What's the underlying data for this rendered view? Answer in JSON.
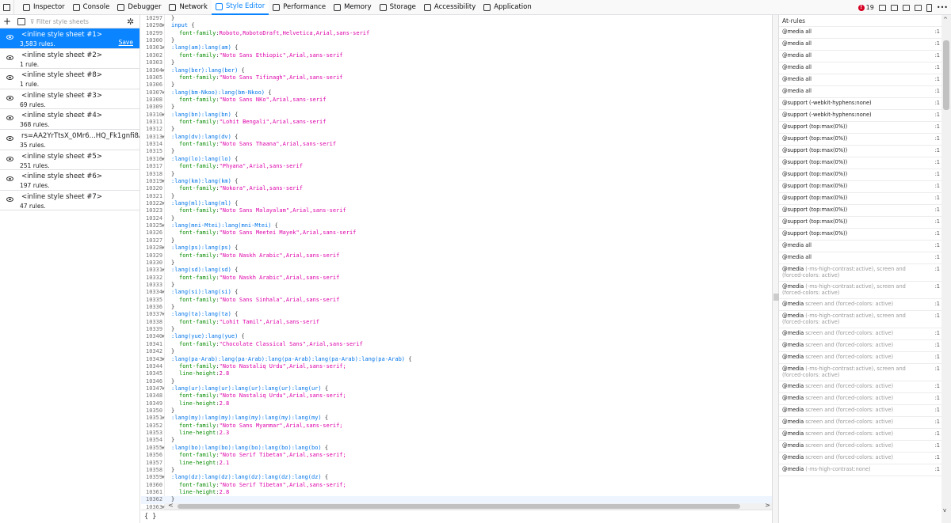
{
  "toolbar": {
    "tabs": [
      {
        "label": "Inspector",
        "icon": "inspector-icon"
      },
      {
        "label": "Console",
        "icon": "console-icon"
      },
      {
        "label": "Debugger",
        "icon": "debugger-icon"
      },
      {
        "label": "Network",
        "icon": "network-icon"
      },
      {
        "label": "Style Editor",
        "icon": "style-editor-icon",
        "active": true
      },
      {
        "label": "Performance",
        "icon": "performance-icon"
      },
      {
        "label": "Memory",
        "icon": "memory-icon"
      },
      {
        "label": "Storage",
        "icon": "storage-icon"
      },
      {
        "label": "Accessibility",
        "icon": "accessibility-icon"
      },
      {
        "label": "Application",
        "icon": "application-icon"
      }
    ],
    "error_count": "19",
    "more_label": "•••"
  },
  "sidebar": {
    "filter_placeholder": "Filter style sheets",
    "save_label": "Save",
    "sheets": [
      {
        "name": "<inline style sheet #1>",
        "rules": "3,583 rules.",
        "selected": true
      },
      {
        "name": "<inline style sheet #2>",
        "rules": "1 rule."
      },
      {
        "name": "<inline style sheet #8>",
        "rules": "1 rule."
      },
      {
        "name": "<inline style sheet #3>",
        "rules": "69 rules."
      },
      {
        "name": "<inline style sheet #4>",
        "rules": "368 rules."
      },
      {
        "name": "rs=AA2YrTtsX_0Mr6...HQ_Fk1gnfi8AjkTg",
        "rules": "35 rules."
      },
      {
        "name": "<inline style sheet #5>",
        "rules": "251 rules."
      },
      {
        "name": "<inline style sheet #6>",
        "rules": "197 rules."
      },
      {
        "name": "<inline style sheet #7>",
        "rules": "47 rules."
      }
    ]
  },
  "editor": {
    "lines": [
      {
        "n": "10297",
        "t": "}"
      },
      {
        "n": "10298",
        "f": true,
        "sel": "input",
        "open": true
      },
      {
        "n": "10299",
        "prop": "font-family",
        "val": "Roboto,RobotoDraft,Helvetica,Arial,sans-serif"
      },
      {
        "n": "10300",
        "t": "}"
      },
      {
        "n": "10301",
        "f": true,
        "sel": ":lang(am):lang(am)",
        "open": true
      },
      {
        "n": "10302",
        "prop": "font-family",
        "val": "\"Noto Sans Ethiopic\",Arial,sans-serif"
      },
      {
        "n": "10303",
        "t": "}"
      },
      {
        "n": "10304",
        "f": true,
        "sel": ":lang(ber):lang(ber)",
        "open": true
      },
      {
        "n": "10305",
        "prop": "font-family",
        "val": "\"Noto Sans Tifinagh\",Arial,sans-serif"
      },
      {
        "n": "10306",
        "t": "}"
      },
      {
        "n": "10307",
        "f": true,
        "sel": ":lang(bm-Nkoo):lang(bm-Nkoo)",
        "open": true
      },
      {
        "n": "10308",
        "prop": "font-family",
        "val": "\"Noto Sans NKo\",Arial,sans-serif"
      },
      {
        "n": "10309",
        "t": "}"
      },
      {
        "n": "10310",
        "f": true,
        "sel": ":lang(bn):lang(bn)",
        "open": true
      },
      {
        "n": "10311",
        "prop": "font-family",
        "val": "\"Lohit Bengali\",Arial,sans-serif"
      },
      {
        "n": "10312",
        "t": "}"
      },
      {
        "n": "10313",
        "f": true,
        "sel": ":lang(dv):lang(dv)",
        "open": true
      },
      {
        "n": "10314",
        "prop": "font-family",
        "val": "\"Noto Sans Thaana\",Arial,sans-serif"
      },
      {
        "n": "10315",
        "t": "}"
      },
      {
        "n": "10316",
        "f": true,
        "sel": ":lang(lo):lang(lo)",
        "open": true
      },
      {
        "n": "10317",
        "prop": "font-family",
        "val": "\"Phyana\",Arial,sans-serif"
      },
      {
        "n": "10318",
        "t": "}"
      },
      {
        "n": "10319",
        "f": true,
        "sel": ":lang(km):lang(km)",
        "open": true
      },
      {
        "n": "10320",
        "prop": "font-family",
        "val": "\"Nokora\",Arial,sans-serif"
      },
      {
        "n": "10321",
        "t": "}"
      },
      {
        "n": "10322",
        "f": true,
        "sel": ":lang(ml):lang(ml)",
        "open": true
      },
      {
        "n": "10323",
        "prop": "font-family",
        "val": "\"Noto Sans Malayalam\",Arial,sans-serif"
      },
      {
        "n": "10324",
        "t": "}"
      },
      {
        "n": "10325",
        "f": true,
        "sel": ":lang(mni-Mtei):lang(mni-Mtei)",
        "open": true
      },
      {
        "n": "10326",
        "prop": "font-family",
        "val": "\"Noto Sans Meetei Mayek\",Arial,sans-serif"
      },
      {
        "n": "10327",
        "t": "}"
      },
      {
        "n": "10328",
        "f": true,
        "sel": ":lang(ps):lang(ps)",
        "open": true
      },
      {
        "n": "10329",
        "prop": "font-family",
        "val": "\"Noto Naskh Arabic\",Arial,sans-serif"
      },
      {
        "n": "10330",
        "t": "}"
      },
      {
        "n": "10331",
        "f": true,
        "sel": ":lang(sd):lang(sd)",
        "open": true
      },
      {
        "n": "10332",
        "prop": "font-family",
        "val": "\"Noto Naskh Arabic\",Arial,sans-serif"
      },
      {
        "n": "10333",
        "t": "}"
      },
      {
        "n": "10334",
        "f": true,
        "sel": ":lang(si):lang(si)",
        "open": true
      },
      {
        "n": "10335",
        "prop": "font-family",
        "val": "\"Noto Sans Sinhala\",Arial,sans-serif"
      },
      {
        "n": "10336",
        "t": "}"
      },
      {
        "n": "10337",
        "f": true,
        "sel": ":lang(ta):lang(ta)",
        "open": true
      },
      {
        "n": "10338",
        "prop": "font-family",
        "val": "\"Lohit Tamil\",Arial,sans-serif"
      },
      {
        "n": "10339",
        "t": "}"
      },
      {
        "n": "10340",
        "f": true,
        "sel": ":lang(yue):lang(yue)",
        "open": true
      },
      {
        "n": "10341",
        "prop": "font-family",
        "val": "\"Chocolate Classical Sans\",Arial,sans-serif"
      },
      {
        "n": "10342",
        "t": "}"
      },
      {
        "n": "10343",
        "f": true,
        "sel": ":lang(pa-Arab):lang(pa-Arab):lang(pa-Arab):lang(pa-Arab):lang(pa-Arab)",
        "open": true
      },
      {
        "n": "10344",
        "prop": "font-family",
        "val": "\"Noto Nastaliq Urdu\",Arial,sans-serif;"
      },
      {
        "n": "10345",
        "prop": "line-height",
        "val": "2.8"
      },
      {
        "n": "10346",
        "t": "}"
      },
      {
        "n": "10347",
        "f": true,
        "sel": ":lang(ur):lang(ur):lang(ur):lang(ur):lang(ur)",
        "open": true
      },
      {
        "n": "10348",
        "prop": "font-family",
        "val": "\"Noto Nastaliq Urdu\",Arial,sans-serif;"
      },
      {
        "n": "10349",
        "prop": "line-height",
        "val": "2.8"
      },
      {
        "n": "10350",
        "t": "}"
      },
      {
        "n": "10351",
        "f": true,
        "sel": ":lang(my):lang(my):lang(my):lang(my):lang(my)",
        "open": true
      },
      {
        "n": "10352",
        "prop": "font-family",
        "val": "\"Noto Sans Myanmar\",Arial,sans-serif;"
      },
      {
        "n": "10353",
        "prop": "line-height",
        "val": "2.3"
      },
      {
        "n": "10354",
        "t": "}"
      },
      {
        "n": "10355",
        "f": true,
        "sel": ":lang(bo):lang(bo):lang(bo):lang(bo):lang(bo)",
        "open": true
      },
      {
        "n": "10356",
        "prop": "font-family",
        "val": "\"Noto Serif Tibetan\",Arial,sans-serif;"
      },
      {
        "n": "10357",
        "prop": "line-height",
        "val": "2.1"
      },
      {
        "n": "10358",
        "t": "}"
      },
      {
        "n": "10359",
        "f": true,
        "sel": ":lang(dz):lang(dz):lang(dz):lang(dz):lang(dz)",
        "open": true
      },
      {
        "n": "10360",
        "prop": "font-family",
        "val": "\"Noto Serif Tibetan\",Arial,sans-serif;"
      },
      {
        "n": "10361",
        "prop": "line-height",
        "val": "2.8"
      },
      {
        "n": "10362",
        "t": "}"
      },
      {
        "n": "10363",
        "f": true,
        "t": ""
      }
    ],
    "pretty_print_label": "{ }"
  },
  "atrules": {
    "title": "At-rules",
    "items": [
      {
        "label": "@media all",
        "line": ":1"
      },
      {
        "label": "@media all",
        "line": ":1"
      },
      {
        "label": "@media all",
        "line": ":1"
      },
      {
        "label": "@media all",
        "line": ":1"
      },
      {
        "label": "@media all",
        "line": ":1"
      },
      {
        "label": "@media all",
        "line": ":1"
      },
      {
        "label": "@support (-webkit-hyphens:none)",
        "line": ":1"
      },
      {
        "label": "@support (-webkit-hyphens:none)",
        "line": ":1"
      },
      {
        "label": "@support (top:max(0%))",
        "line": ":1"
      },
      {
        "label": "@support (top:max(0%))",
        "line": ":1"
      },
      {
        "label": "@support (top:max(0%))",
        "line": ":1"
      },
      {
        "label": "@support (top:max(0%))",
        "line": ":1"
      },
      {
        "label": "@support (top:max(0%))",
        "line": ":1"
      },
      {
        "label": "@support (top:max(0%))",
        "line": ":1"
      },
      {
        "label": "@support (top:max(0%))",
        "line": ":1"
      },
      {
        "label": "@support (top:max(0%))",
        "line": ":1"
      },
      {
        "label": "@support (top:max(0%))",
        "line": ":1"
      },
      {
        "label": "@support (top:max(0%))",
        "line": ":1"
      },
      {
        "label": "@media all",
        "line": ":1"
      },
      {
        "label": "@media all",
        "line": ":1"
      },
      {
        "label": "@media",
        "cond": "(-ms-high-contrast:active), screen and (forced-colors: active)",
        "line": ":1"
      },
      {
        "label": "@media",
        "cond": "(-ms-high-contrast:active), screen and (forced-colors: active)",
        "line": ":1"
      },
      {
        "label": "@media",
        "cond": "screen and (forced-colors: active)",
        "line": ":1"
      },
      {
        "label": "@media",
        "cond": "(-ms-high-contrast:active), screen and (forced-colors: active)",
        "line": ":1"
      },
      {
        "label": "@media",
        "cond": "screen and (forced-colors: active)",
        "line": ":1"
      },
      {
        "label": "@media",
        "cond": "screen and (forced-colors: active)",
        "line": ":1"
      },
      {
        "label": "@media",
        "cond": "screen and (forced-colors: active)",
        "line": ":1"
      },
      {
        "label": "@media",
        "cond": "(-ms-high-contrast:active), screen and (forced-colors: active)",
        "line": ":1"
      },
      {
        "label": "@media",
        "cond": "screen and (forced-colors: active)",
        "line": ":1"
      },
      {
        "label": "@media",
        "cond": "screen and (forced-colors: active)",
        "line": ":1"
      },
      {
        "label": "@media",
        "cond": "screen and (forced-colors: active)",
        "line": ":1"
      },
      {
        "label": "@media",
        "cond": "screen and (forced-colors: active)",
        "line": ":1"
      },
      {
        "label": "@media",
        "cond": "screen and (forced-colors: active)",
        "line": ":1"
      },
      {
        "label": "@media",
        "cond": "screen and (forced-colors: active)",
        "line": ":1"
      },
      {
        "label": "@media",
        "cond": "screen and (forced-colors: active)",
        "line": ":1"
      },
      {
        "label": "@media",
        "cond": "(-ms-high-contrast:none)",
        "line": ":1"
      }
    ]
  }
}
